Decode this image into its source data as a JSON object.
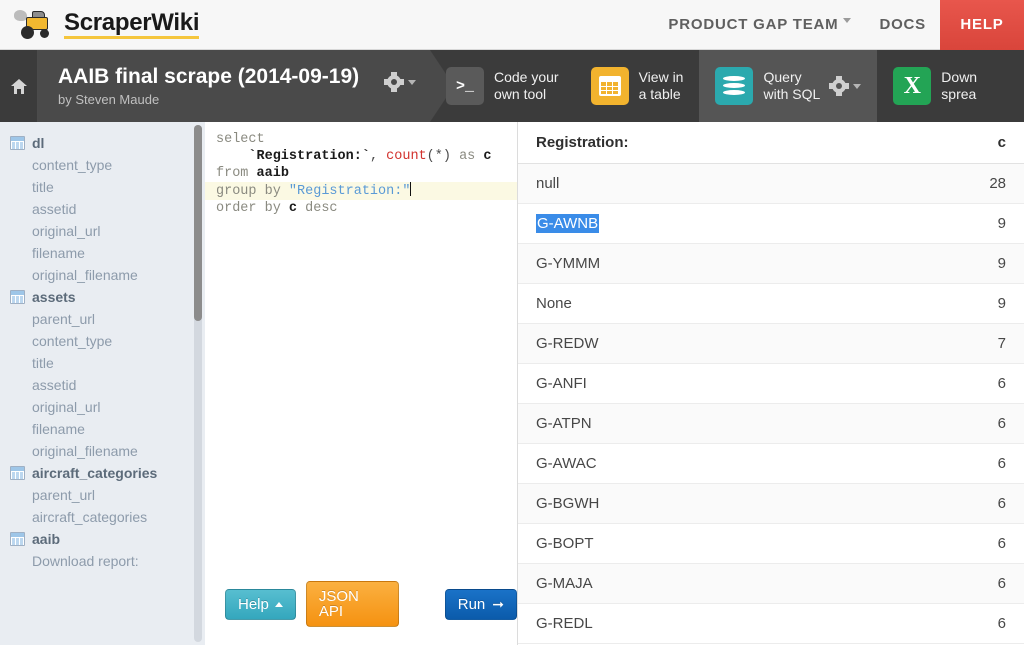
{
  "topbar": {
    "brand_name": "ScraperWiki",
    "brand_logo_icon": "steamroller-icon",
    "nav": [
      {
        "label": "PRODUCT GAP TEAM",
        "has_caret": true,
        "icon": "chevron-down-icon"
      },
      {
        "label": "DOCS",
        "has_caret": false
      }
    ],
    "help_label": "HELP",
    "help_color": "#d9453b"
  },
  "toolbar": {
    "home_icon": "home-icon",
    "dataset_title": "AAIB final scrape (2014-09-19)",
    "dataset_byline": "by Steven Maude",
    "title_gear_icon": "gear-icon",
    "tools": [
      {
        "label_line1": "Code your",
        "label_line2": "own tool",
        "icon": "terminal-icon",
        "icon_glyph": ">_",
        "icon_color": "#5a5a5a",
        "active": false,
        "has_gear": false
      },
      {
        "label_line1": "View in",
        "label_line2": "a table",
        "icon": "table-grid-icon",
        "icon_color": "#f2b32e",
        "active": false,
        "has_gear": false
      },
      {
        "label_line1": "Query",
        "label_line2": "with SQL",
        "icon": "database-icon",
        "icon_color": "#2ba9ae",
        "active": true,
        "has_gear": true
      },
      {
        "label_line1": "Down",
        "label_line2": "sprea",
        "icon": "excel-icon",
        "icon_glyph": "X",
        "icon_color": "#23a455",
        "active": false,
        "has_gear": false
      }
    ]
  },
  "sidebar": {
    "tables": [
      {
        "name": "dl",
        "icon": "table-icon",
        "columns": [
          "content_type",
          "title",
          "assetid",
          "original_url",
          "filename",
          "original_filename"
        ]
      },
      {
        "name": "assets",
        "icon": "table-icon",
        "columns": [
          "parent_url",
          "content_type",
          "title",
          "assetid",
          "original_url",
          "filename",
          "original_filename"
        ]
      },
      {
        "name": "aircraft_categories",
        "icon": "table-icon",
        "columns": [
          "parent_url",
          "aircraft_categories"
        ]
      },
      {
        "name": "aaib",
        "icon": "table-icon",
        "columns": [
          "Download report:"
        ]
      }
    ]
  },
  "editor": {
    "lines": [
      [
        {
          "t": "select",
          "c": "kw"
        }
      ],
      [
        {
          "t": "    ",
          "c": "punct"
        },
        {
          "t": "`Registration:`",
          "c": "ident"
        },
        {
          "t": ", ",
          "c": "punct"
        },
        {
          "t": "count",
          "c": "fn"
        },
        {
          "t": "(*) ",
          "c": "punct"
        },
        {
          "t": "as ",
          "c": "kw"
        },
        {
          "t": "c",
          "c": "ident"
        }
      ],
      [
        {
          "t": "from ",
          "c": "kw"
        },
        {
          "t": "aaib",
          "c": "ident"
        }
      ],
      [
        {
          "t": "group by ",
          "c": "kw"
        },
        {
          "t": "\"Registration:\"",
          "c": "str"
        }
      ],
      [
        {
          "t": "order by ",
          "c": "kw"
        },
        {
          "t": "c",
          "c": "ident"
        },
        {
          "t": " desc",
          "c": "kw"
        }
      ]
    ],
    "active_line_index": 3,
    "full_query": "select\n    `Registration:`, count(*) as c\nfrom aaib\ngroup by \"Registration:\"\norder by c desc",
    "buttons": {
      "help_label": "Help",
      "help_caret_icon": "caret-up-icon",
      "json_label": "JSON API",
      "run_label": "Run",
      "run_arrow_icon": "arrow-right-icon"
    }
  },
  "results": {
    "columns": [
      {
        "label": "Registration:",
        "align": "left"
      },
      {
        "label": "c",
        "align": "right"
      }
    ],
    "selected_cell": "G-AWNB",
    "selection_color": "#3a8ce8",
    "rows": [
      {
        "registration": "null",
        "c": "28",
        "selected": false
      },
      {
        "registration": "G-AWNB",
        "c": "9",
        "selected": true
      },
      {
        "registration": "G-YMMM",
        "c": "9",
        "selected": false
      },
      {
        "registration": "None",
        "c": "9",
        "selected": false
      },
      {
        "registration": "G-REDW",
        "c": "7",
        "selected": false
      },
      {
        "registration": "G-ANFI",
        "c": "6",
        "selected": false
      },
      {
        "registration": "G-ATPN",
        "c": "6",
        "selected": false
      },
      {
        "registration": "G-AWAC",
        "c": "6",
        "selected": false
      },
      {
        "registration": "G-BGWH",
        "c": "6",
        "selected": false
      },
      {
        "registration": "G-BOPT",
        "c": "6",
        "selected": false
      },
      {
        "registration": "G-MAJA",
        "c": "6",
        "selected": false
      },
      {
        "registration": "G-REDL",
        "c": "6",
        "selected": false
      }
    ]
  }
}
